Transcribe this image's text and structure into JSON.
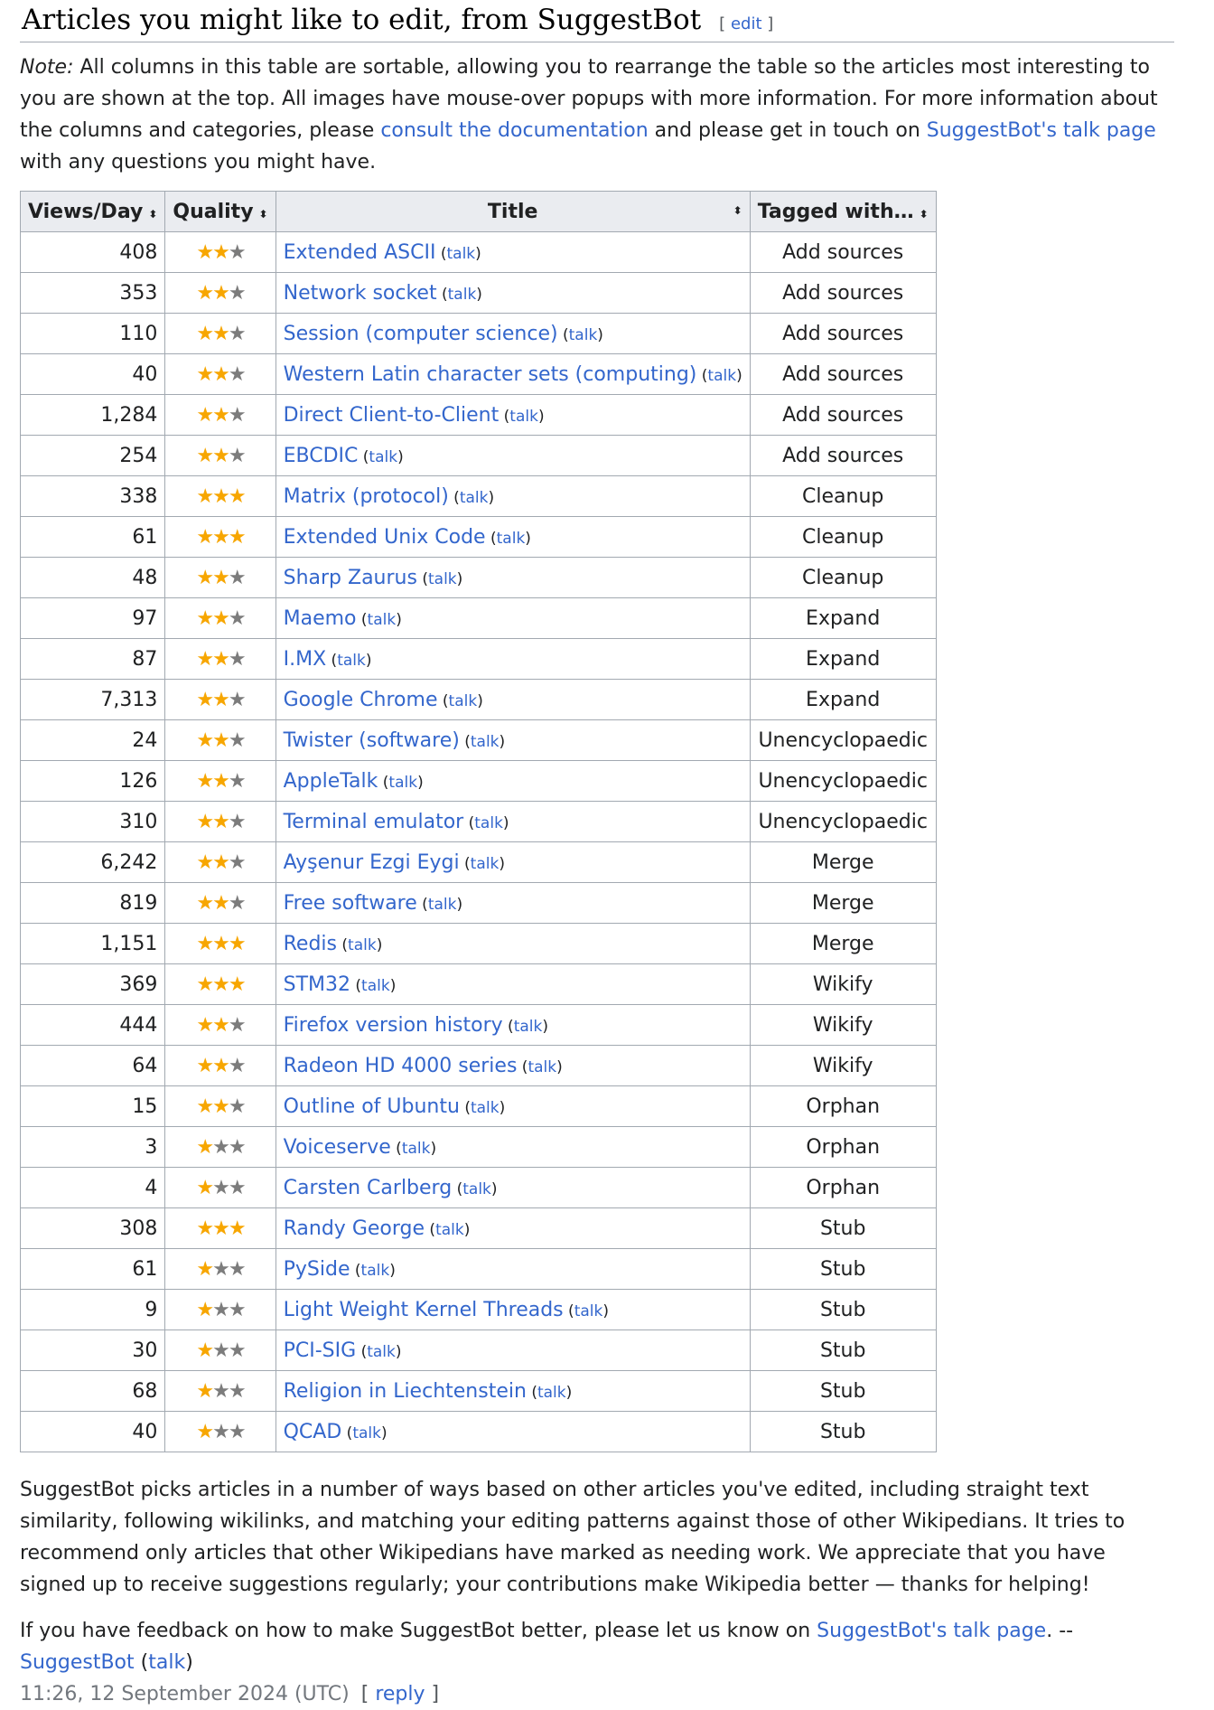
{
  "heading": {
    "title": "Articles you might like to edit, from SuggestBot",
    "edit_prefix": "[",
    "edit_label": "edit",
    "edit_suffix": "]"
  },
  "note": {
    "label": "Note:",
    "text1": " All columns in this table are sortable, allowing you to rearrange the table so the articles most interesting to you are shown at the top. All images have mouse-over popups with more information. For more information about the columns and categories, please ",
    "doc_link": "consult the documentation",
    "text2": " and please get in touch on ",
    "talk_link": "SuggestBot's talk page",
    "text3": " with any questions you might have."
  },
  "table": {
    "headers": {
      "views": "Views/Day",
      "quality": "Quality",
      "title": "Title",
      "tagged": "Tagged with…"
    },
    "sort_glyph": "⬍",
    "talk_label": "talk",
    "rows": [
      {
        "views": "408",
        "stars": 2,
        "title": "Extended ASCII",
        "tag": "Add sources"
      },
      {
        "views": "353",
        "stars": 2,
        "title": "Network socket",
        "tag": "Add sources"
      },
      {
        "views": "110",
        "stars": 2,
        "title": "Session (computer science)",
        "tag": "Add sources"
      },
      {
        "views": "40",
        "stars": 2,
        "title": "Western Latin character sets (computing)",
        "tag": "Add sources"
      },
      {
        "views": "1,284",
        "stars": 2,
        "title": "Direct Client-to-Client",
        "tag": "Add sources"
      },
      {
        "views": "254",
        "stars": 2,
        "title": "EBCDIC",
        "tag": "Add sources"
      },
      {
        "views": "338",
        "stars": 3,
        "title": "Matrix (protocol)",
        "tag": "Cleanup"
      },
      {
        "views": "61",
        "stars": 3,
        "title": "Extended Unix Code",
        "tag": "Cleanup"
      },
      {
        "views": "48",
        "stars": 2,
        "title": "Sharp Zaurus",
        "tag": "Cleanup"
      },
      {
        "views": "97",
        "stars": 2,
        "title": "Maemo",
        "tag": "Expand"
      },
      {
        "views": "87",
        "stars": 2,
        "title": "I.MX",
        "tag": "Expand"
      },
      {
        "views": "7,313",
        "stars": 2,
        "title": "Google Chrome",
        "tag": "Expand"
      },
      {
        "views": "24",
        "stars": 2,
        "title": "Twister (software)",
        "tag": "Unencyclopaedic"
      },
      {
        "views": "126",
        "stars": 2,
        "title": "AppleTalk",
        "tag": "Unencyclopaedic"
      },
      {
        "views": "310",
        "stars": 2,
        "title": "Terminal emulator",
        "tag": "Unencyclopaedic"
      },
      {
        "views": "6,242",
        "stars": 2,
        "title": "Ayşenur Ezgi Eygi",
        "tag": "Merge"
      },
      {
        "views": "819",
        "stars": 2,
        "title": "Free software",
        "tag": "Merge"
      },
      {
        "views": "1,151",
        "stars": 3,
        "title": "Redis",
        "tag": "Merge"
      },
      {
        "views": "369",
        "stars": 3,
        "title": "STM32",
        "tag": "Wikify"
      },
      {
        "views": "444",
        "stars": 2,
        "title": "Firefox version history",
        "tag": "Wikify"
      },
      {
        "views": "64",
        "stars": 2,
        "title": "Radeon HD 4000 series",
        "tag": "Wikify"
      },
      {
        "views": "15",
        "stars": 2,
        "title": "Outline of Ubuntu",
        "tag": "Orphan"
      },
      {
        "views": "3",
        "stars": 1,
        "title": "Voiceserve",
        "tag": "Orphan"
      },
      {
        "views": "4",
        "stars": 1,
        "title": "Carsten Carlberg",
        "tag": "Orphan"
      },
      {
        "views": "308",
        "stars": 3,
        "title": "Randy George",
        "tag": "Stub"
      },
      {
        "views": "61",
        "stars": 1,
        "title": "PySide",
        "tag": "Stub"
      },
      {
        "views": "9",
        "stars": 1,
        "title": "Light Weight Kernel Threads",
        "tag": "Stub"
      },
      {
        "views": "30",
        "stars": 1,
        "title": "PCI-SIG",
        "tag": "Stub"
      },
      {
        "views": "68",
        "stars": 1,
        "title": "Religion in Liechtenstein",
        "tag": "Stub"
      },
      {
        "views": "40",
        "stars": 1,
        "title": "QCAD",
        "tag": "Stub"
      }
    ]
  },
  "colors": {
    "link": "#3366cc",
    "star_filled": "#f7a600",
    "star_empty": "#7c7c7c",
    "header_bg": "#eaecf0",
    "border": "#a2a9b1"
  },
  "footer": {
    "para1": "SuggestBot picks articles in a number of ways based on other articles you've edited, including straight text similarity, following wikilinks, and matching your editing patterns against those of other Wikipedians. It tries to recommend only articles that other Wikipedians have marked as needing work. We appreciate that you have signed up to receive suggestions regularly; your contributions make Wikipedia better — thanks for helping!",
    "para2_text": "If you have feedback on how to make SuggestBot better, please let us know on ",
    "para2_link": "SuggestBot's talk page",
    "para2_sep": ". -- ",
    "sig_user": "SuggestBot",
    "sig_talk_open": " (",
    "sig_talk": "talk",
    "sig_talk_close": ")",
    "timestamp": "11:26, 12 September 2024 (UTC)",
    "reply_open": "[",
    "reply_label": "reply",
    "reply_close": "]"
  }
}
